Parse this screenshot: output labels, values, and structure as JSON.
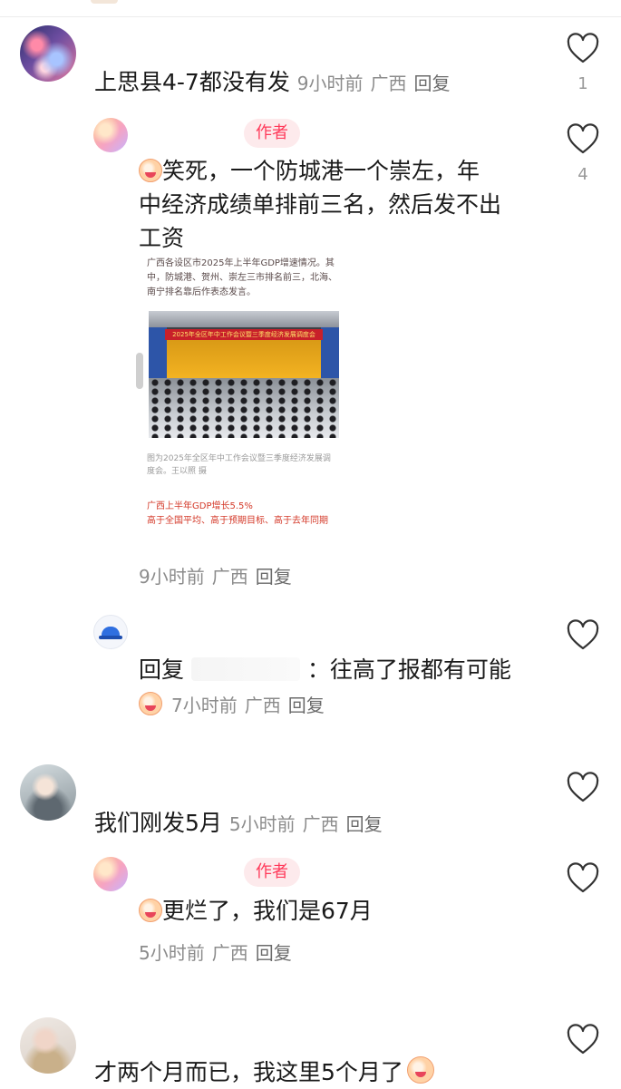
{
  "comments": [
    {
      "text": "上思县4-7都没有发",
      "time": "9小时前",
      "location": "广西",
      "reply_label": "回复",
      "likes": "1",
      "replies": [
        {
          "author_tag": "作者",
          "text_lines": [
            "笑死，一个防城港一个崇左，年",
            "中经济成绩单排前三名，然后发不出",
            "工资"
          ],
          "time": "9小时前",
          "location": "广西",
          "reply_label": "回复",
          "likes": "4",
          "image": {
            "intro_text": "广西各设区市2025年上半年GDP增速情况。其中，防城港、贺州、崇左三市排名前三，北海、南宁排名靠后作表态发言。",
            "banner_text": "2025年全区年中工作会议暨三季度经济发展调度会",
            "caption": "图为2025年全区年中工作会议暨三季度经济发展调度会。王以照 摄",
            "highlight_1": "广西上半年GDP增长5.5%",
            "highlight_2": "高于全国平均、高于预期目标、高于去年同期"
          }
        },
        {
          "prefix": "回复",
          "text": "：往高了报都有可能",
          "time": "7小时前",
          "location": "广西",
          "reply_label": "回复"
        }
      ]
    },
    {
      "text": "我们刚发5月",
      "time": "5小时前",
      "location": "广西",
      "reply_label": "回复",
      "replies": [
        {
          "author_tag": "作者",
          "text": "更烂了，我们是67月",
          "time": "5小时前",
          "location": "广西",
          "reply_label": "回复"
        }
      ]
    },
    {
      "text": "才两个月而已，我这里5个月了"
    }
  ],
  "icons": {
    "like": "heart-outline-icon",
    "emoji": "crying-laughing-emoji-icon"
  },
  "colors": {
    "author_tag_text": "#ff3a5a",
    "author_tag_bg": "#fdeaec",
    "meta_text": "#8c8c8c"
  }
}
